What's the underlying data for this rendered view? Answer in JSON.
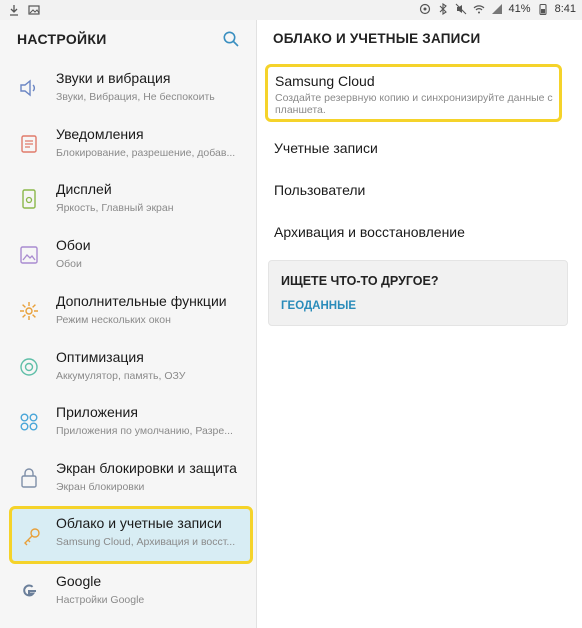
{
  "statusbar": {
    "battery": "41%",
    "time": "8:41"
  },
  "left_panel": {
    "title": "НАСТРОЙКИ",
    "items": [
      {
        "icon": "sound-icon",
        "title": "Звуки и вибрация",
        "subtitle": "Звуки, Вибрация, Не беспокоить"
      },
      {
        "icon": "notifications-icon",
        "title": "Уведомления",
        "subtitle": "Блокирование, разрешение, добав..."
      },
      {
        "icon": "display-icon",
        "title": "Дисплей",
        "subtitle": "Яркость, Главный экран"
      },
      {
        "icon": "wallpaper-icon",
        "title": "Обои",
        "subtitle": "Обои"
      },
      {
        "icon": "advanced-features-icon",
        "title": "Дополнительные функции",
        "subtitle": "Режим нескольких окон"
      },
      {
        "icon": "optimization-icon",
        "title": "Оптимизация",
        "subtitle": "Аккумулятор, память, ОЗУ"
      },
      {
        "icon": "apps-icon",
        "title": "Приложения",
        "subtitle": "Приложения по умолчанию, Разре..."
      },
      {
        "icon": "lock-screen-icon",
        "title": "Экран блокировки и защита",
        "subtitle": "Экран блокировки"
      },
      {
        "icon": "cloud-accounts-icon",
        "title": "Облако и учетные записи",
        "subtitle": "Samsung Cloud, Архивация и восст..."
      },
      {
        "icon": "google-icon",
        "title": "Google",
        "subtitle": "Настройки Google"
      }
    ]
  },
  "right_panel": {
    "title": "ОБЛАКО И УЧЕТНЫЕ ЗАПИСИ",
    "samsung_cloud": {
      "title": "Samsung Cloud",
      "subtitle": "Создайте резервную копию и синхронизируйте данные с планшета."
    },
    "items": [
      "Учетные записи",
      "Пользователи",
      "Архивация и восстановление"
    ],
    "looking_for": {
      "title": "ИЩЕТЕ ЧТО-ТО ДРУГОЕ?",
      "link": "ГЕОДАННЫЕ"
    }
  },
  "colors": {
    "highlight_border": "#f5d32a",
    "active_bg": "#d8edf4",
    "link": "#2a8cba"
  }
}
